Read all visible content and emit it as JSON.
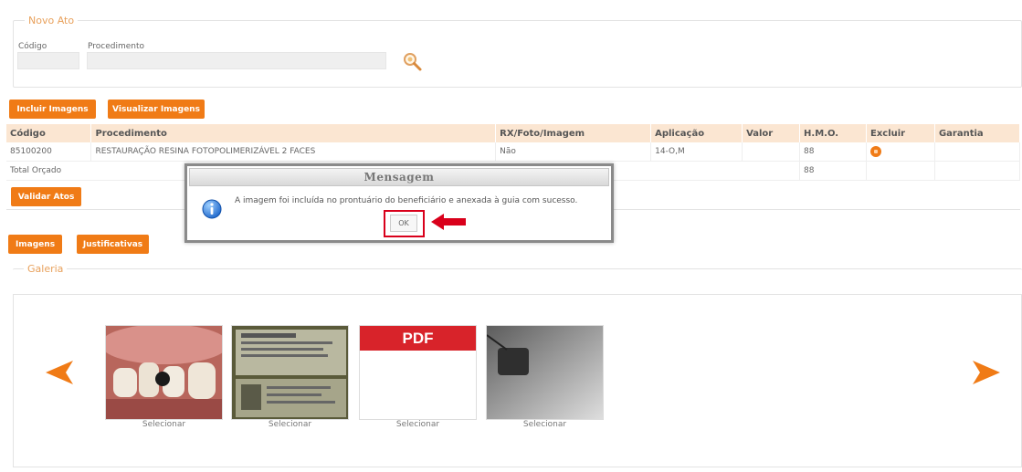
{
  "novo_ato": {
    "legend": "Novo Ato",
    "codigo_label": "Código",
    "procedimento_label": "Procedimento",
    "codigo_value": "",
    "procedimento_value": ""
  },
  "buttons": {
    "incluir_imagens": "Incluir Imagens",
    "visualizar_imagens": "Visualizar Imagens",
    "validar_atos": "Validar Atos",
    "imagens": "Imagens",
    "justificativas": "Justificativas"
  },
  "table": {
    "headers": [
      "Código",
      "Procedimento",
      "RX/Foto/Imagem",
      "Aplicação",
      "Valor",
      "H.M.O.",
      "Excluir",
      "Garantia"
    ],
    "row": {
      "codigo": "85100200",
      "procedimento": "RESTAURAÇÃO RESINA FOTOPOLIMERIZÁVEL 2 FACES",
      "rx": "Não",
      "aplicacao": "14-O,M",
      "valor": "",
      "hmo": "88",
      "garantia": ""
    },
    "total": {
      "label": "Total Orçado",
      "hmo": "88"
    }
  },
  "galeria": {
    "legend": "Galeria",
    "items": [
      {
        "type": "photo-teeth",
        "caption": "Selecionar"
      },
      {
        "type": "document-photo",
        "caption": "Selecionar"
      },
      {
        "type": "pdf",
        "label": "PDF",
        "caption": "Selecionar"
      },
      {
        "type": "xray",
        "caption": "Selecionar"
      }
    ]
  },
  "modal": {
    "title": "Mensagem",
    "message": "A imagem foi incluída no prontuário do beneficiário e anexada à guia com sucesso.",
    "ok_label": "OK"
  },
  "icons": {
    "search": "search-icon",
    "info": "info-icon",
    "prev": "arrow-left-icon",
    "next": "arrow-right-icon",
    "delete": "delete-icon",
    "annotation": "red-arrow-icon"
  },
  "colors": {
    "accent": "#f07b16",
    "header_bg": "#fbe6d2",
    "legend": "#e8a15c",
    "highlight": "#d9001b"
  }
}
